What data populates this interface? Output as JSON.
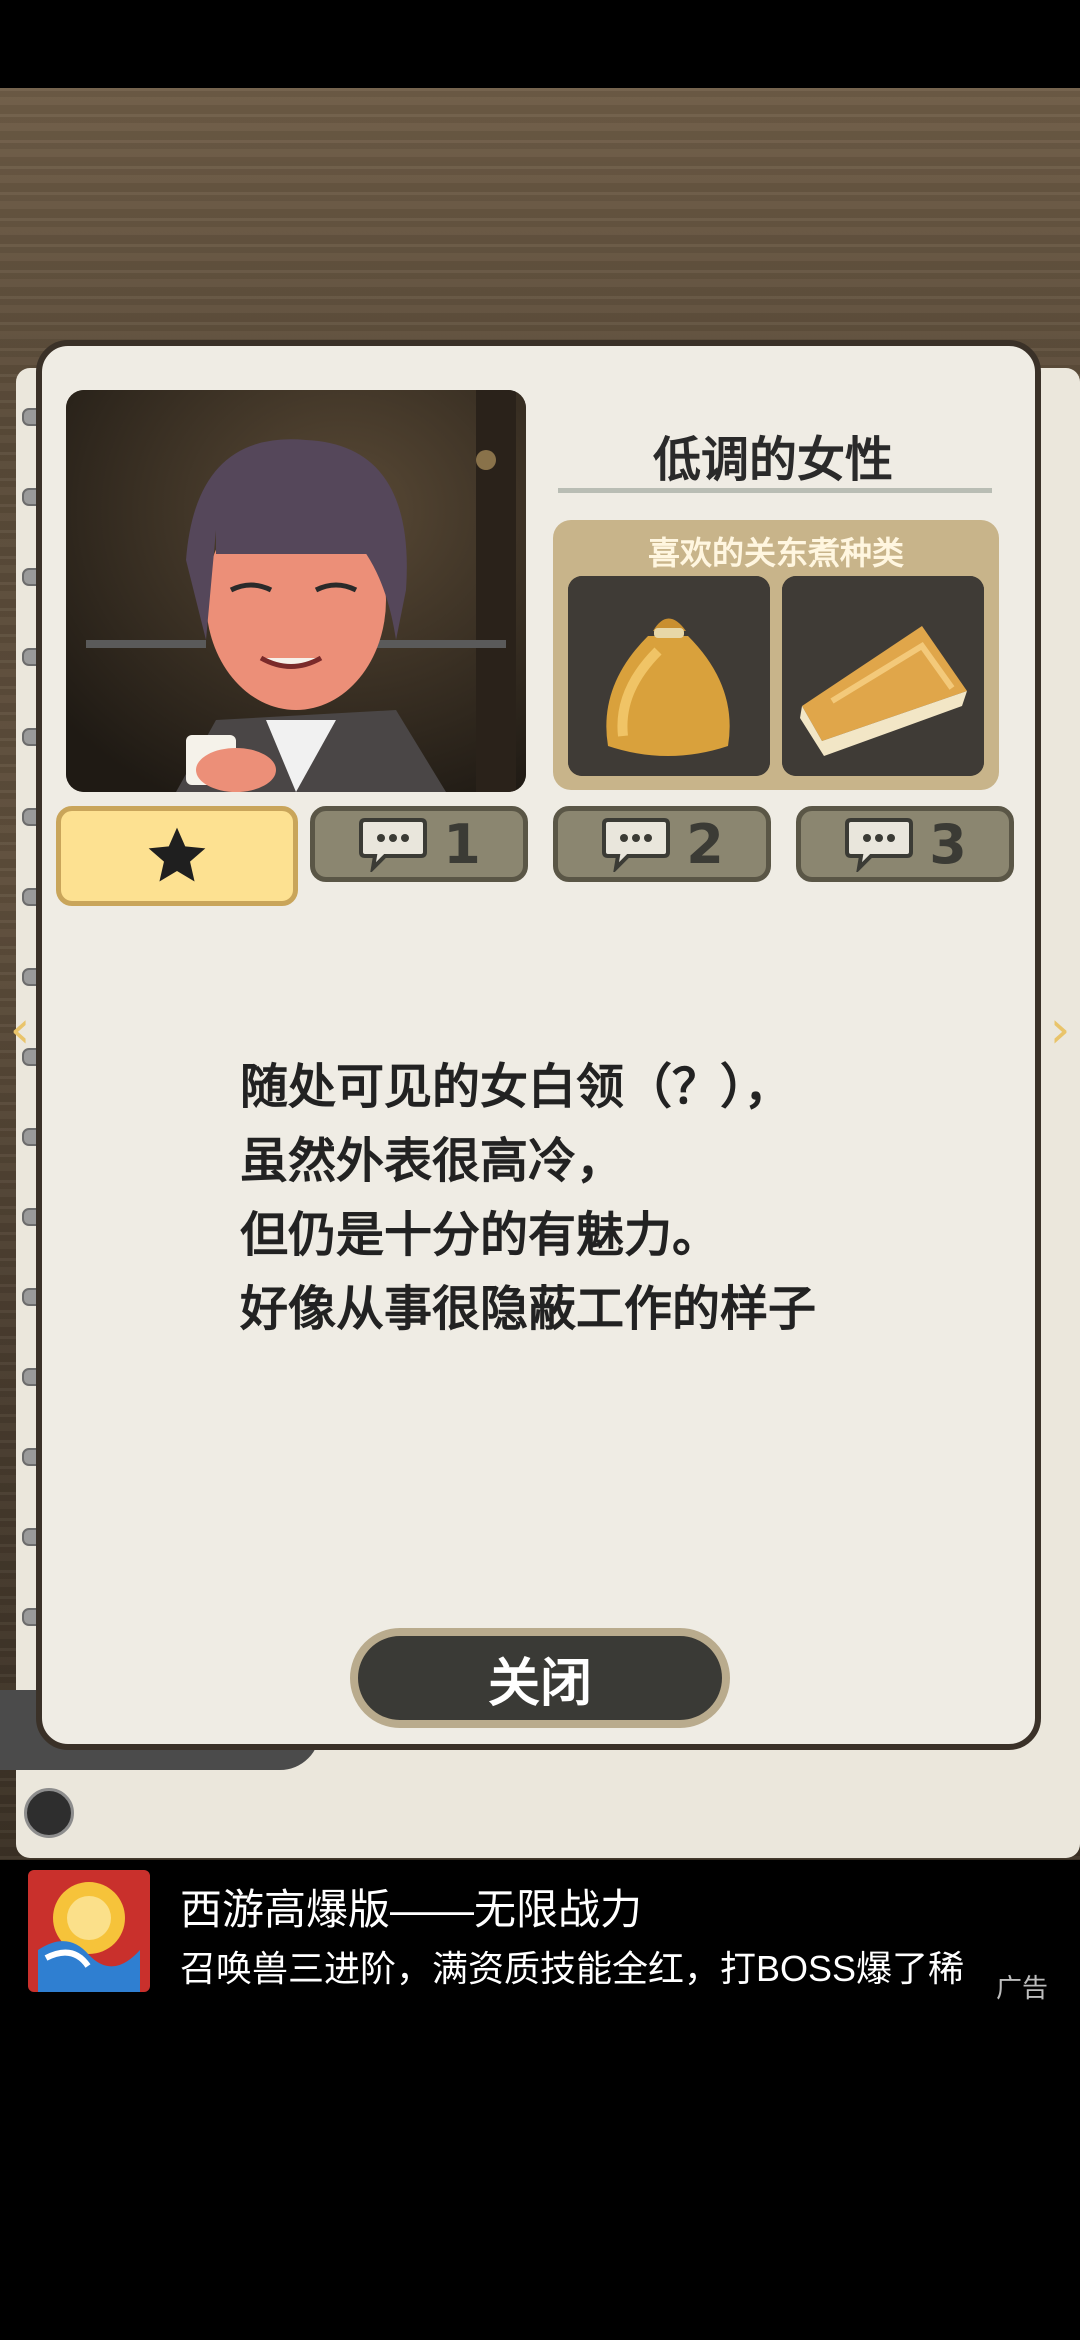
{
  "character": {
    "name": "低调的女性"
  },
  "favorite_food": {
    "title": "喜欢的关东煮种类",
    "items": [
      {
        "icon": "fukuro-bag-icon"
      },
      {
        "icon": "fried-tofu-wedge-icon"
      }
    ]
  },
  "tabs": [
    {
      "icon": "star-icon",
      "label": ""
    },
    {
      "icon": "speech-bubble-icon",
      "label": "1"
    },
    {
      "icon": "speech-bubble-icon",
      "label": "2"
    },
    {
      "icon": "speech-bubble-icon",
      "label": "3"
    }
  ],
  "description": {
    "lines": [
      "随处可见的女白领（？），",
      "虽然外表很高冷，",
      "但仍是十分的有魅力。",
      "好像从事很隐蔽工作的样子"
    ]
  },
  "close_button": {
    "label": "关闭"
  },
  "ad": {
    "title": "西游高爆版——无限战力",
    "subtitle": "召唤兽三进阶，满资质技能全红，打BOSS爆了稀",
    "label": "广告"
  },
  "colors": {
    "card_bg": "#efece4",
    "tab_active": "#fde191",
    "tab_inactive": "#8b8670",
    "food_panel": "#c8b48a",
    "button_dark": "#3a3a36"
  }
}
